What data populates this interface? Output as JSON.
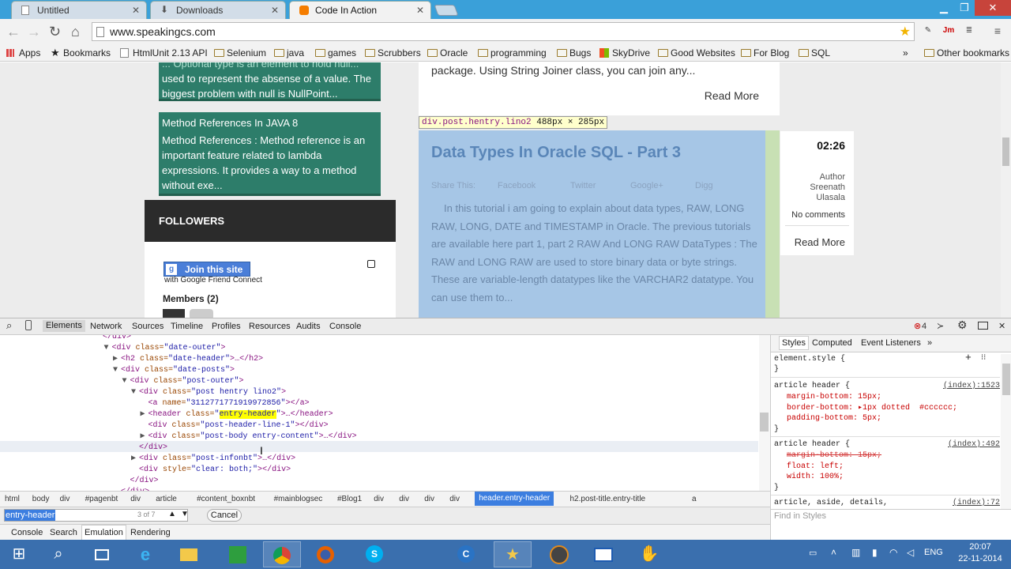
{
  "browser": {
    "tabs": [
      {
        "title": "Untitled",
        "active": false
      },
      {
        "title": "Downloads",
        "active": false
      },
      {
        "title": "Code In Action",
        "active": true
      }
    ],
    "url": "www.speakingcs.com",
    "bookmarks": [
      "Apps",
      "Bookmarks",
      "HtmlUnit 2.13 API",
      "Selenium",
      "java",
      "games",
      "Scrubbers",
      "Oracle",
      "programming",
      "Bugs",
      "SkyDrive",
      "Good Websites",
      "For Blog",
      "SQL"
    ],
    "more_bookmarks": "»",
    "other_bookmarks": "Other bookmarks",
    "extensions": {
      "jmeter": "Jm"
    }
  },
  "page": {
    "sidebar_post1": {
      "line0": "... Optional type is an element to hold null...",
      "lines": [
        "used to represent the absense of a value. The",
        "biggest problem with null is NullPoint..."
      ]
    },
    "sidebar_post2": {
      "title": "Method References In JAVA 8",
      "lines": [
        "Method References :     Method reference is an",
        "important feature related to lambda",
        "expressions. It provides a way to a method",
        "without exe..."
      ]
    },
    "followers_heading": "FOLLOWERS",
    "join_button": "Join this site",
    "join_sub": "with Google Friend Connect",
    "members": "Members (2)",
    "prev_post": {
      "text": "package. Using String Joiner class, you can join any...",
      "read_more": "Read More"
    },
    "inspect_tooltip": {
      "selector": "div.post.hentry.lino2",
      "dims": "488px × 285px"
    },
    "post": {
      "title": "Data Types In Oracle SQL - Part 3",
      "share_label": "Share This:",
      "share_links": [
        "Facebook",
        "Twitter",
        "Google+",
        "Digg"
      ],
      "excerpt": "In this tutorial i am going to explain about data types, RAW, LONG RAW, LONG, DATE and TIMESTAMP in Oracle. The previous tutorials are available here part 1, part 2 RAW And LONG RAW DataTypes :      The RAW and LONG RAW are used to store binary data or byte strings. These are variable-length datatypes like the VARCHAR2 datatype. You can use them to...",
      "time": "02:26",
      "author_label": "Author",
      "author_name1": "Sreenath",
      "author_name2": "Ulasala",
      "comments": "No comments",
      "read_more": "Read More"
    }
  },
  "devtools": {
    "tabs": [
      "Elements",
      "Network",
      "Sources",
      "Timeline",
      "Profiles",
      "Resources",
      "Audits",
      "Console"
    ],
    "error_count": "4",
    "dom_lines": [
      {
        "indent": 0,
        "text": "</div>"
      },
      {
        "indent": 1,
        "open": "div",
        "attr": "class",
        "val": "date-outer"
      },
      {
        "indent": 2,
        "open": "h2",
        "attr": "class",
        "val": "date-header",
        "tail": "…</h2>"
      },
      {
        "indent": 2,
        "open": "div",
        "attr": "class",
        "val": "date-posts"
      },
      {
        "indent": 3,
        "open": "div",
        "attr": "class",
        "val": "post-outer"
      },
      {
        "indent": 4,
        "open": "div",
        "attr": "class",
        "val": "post hentry lino2"
      },
      {
        "indent": 5,
        "open": "a",
        "attr": "name",
        "val": "3112771771919972856",
        "tail": "</a>"
      },
      {
        "indent": 5,
        "open": "header",
        "attr": "class",
        "val": "entry-header",
        "tail": "…</header>"
      },
      {
        "indent": 5,
        "open": "div",
        "attr": "class",
        "val": "post-header-line-1",
        "tail": "</div>"
      },
      {
        "indent": 5,
        "open": "div",
        "attr": "class",
        "val": "post-body entry-content",
        "tail": "…</div>"
      },
      {
        "indent": 4,
        "text": "</div>"
      },
      {
        "indent": 4,
        "open": "div",
        "attr": "class",
        "val": "post-infonbt",
        "tail": "…</div>"
      },
      {
        "indent": 4,
        "open": "div",
        "attr": "style",
        "val": "clear: both;",
        "tail": "</div>"
      },
      {
        "indent": 3,
        "text": "</div>"
      },
      {
        "indent": 2,
        "text": "</div>"
      }
    ],
    "breadcrumbs": [
      "html",
      "body",
      "div",
      "#pagenbt",
      "div",
      "article",
      "#content_boxnbt",
      "#mainblogsec",
      "#Blog1",
      "div",
      "div",
      "div",
      "div",
      "header.entry-header",
      "h2.post-title.entry-title",
      "a"
    ],
    "search": {
      "value": "entry-header",
      "count": "3 of 7",
      "cancel": "Cancel"
    },
    "drawer_tabs": [
      "Console",
      "Search",
      "Emulation",
      "Rendering"
    ],
    "styles_tabs": [
      "Styles",
      "Computed",
      "Event Listeners"
    ],
    "styles_more": "»",
    "element_style": "element.style {",
    "rules": [
      {
        "selector": "article header {",
        "source": "(index):1523",
        "props": [
          "margin-bottom: 15px;",
          "border-bottom: ▸1px dotted  #cccccc;",
          "padding-bottom: 5px;"
        ]
      },
      {
        "selector": "article header {",
        "source": "(index):492",
        "props": [
          "margin-bottom: 15px;",
          "float: left;",
          "width: 100%;"
        ]
      },
      {
        "selector": "article, aside, details,",
        "source": "(index):72",
        "props": []
      }
    ],
    "find_placeholder": "Find in Styles"
  },
  "taskbar": {
    "lang": "ENG",
    "time": "20:07",
    "date": "22-11-2014"
  }
}
